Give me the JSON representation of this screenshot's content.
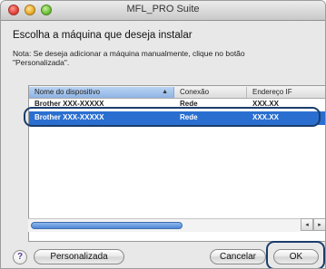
{
  "window": {
    "title": "MFL_PRO Suite"
  },
  "heading": "Escolha a máquina que deseja instalar",
  "note": "Nota: Se deseja adicionar a máquina manualmente, clique no botão \"Personalizada\".",
  "table": {
    "columns": [
      "Nome do dispositivo",
      "Conexão",
      "Endereço IF"
    ],
    "rows": [
      {
        "name": "Brother XXX-XXXXX",
        "connection": "Rede",
        "address": "XXX.XX"
      },
      {
        "name": "Brother XXX-XXXXX",
        "connection": "Rede",
        "address": "XXX.XX",
        "selected": true
      }
    ]
  },
  "scrollbar": {
    "left_arrow": "◂",
    "right_arrow": "▸"
  },
  "buttons": {
    "help": "?",
    "custom": "Personalizada",
    "cancel": "Cancelar",
    "ok": "OK"
  },
  "colors": {
    "selection": "#2a6fd0",
    "highlight_ring": "#1a3d6b"
  }
}
